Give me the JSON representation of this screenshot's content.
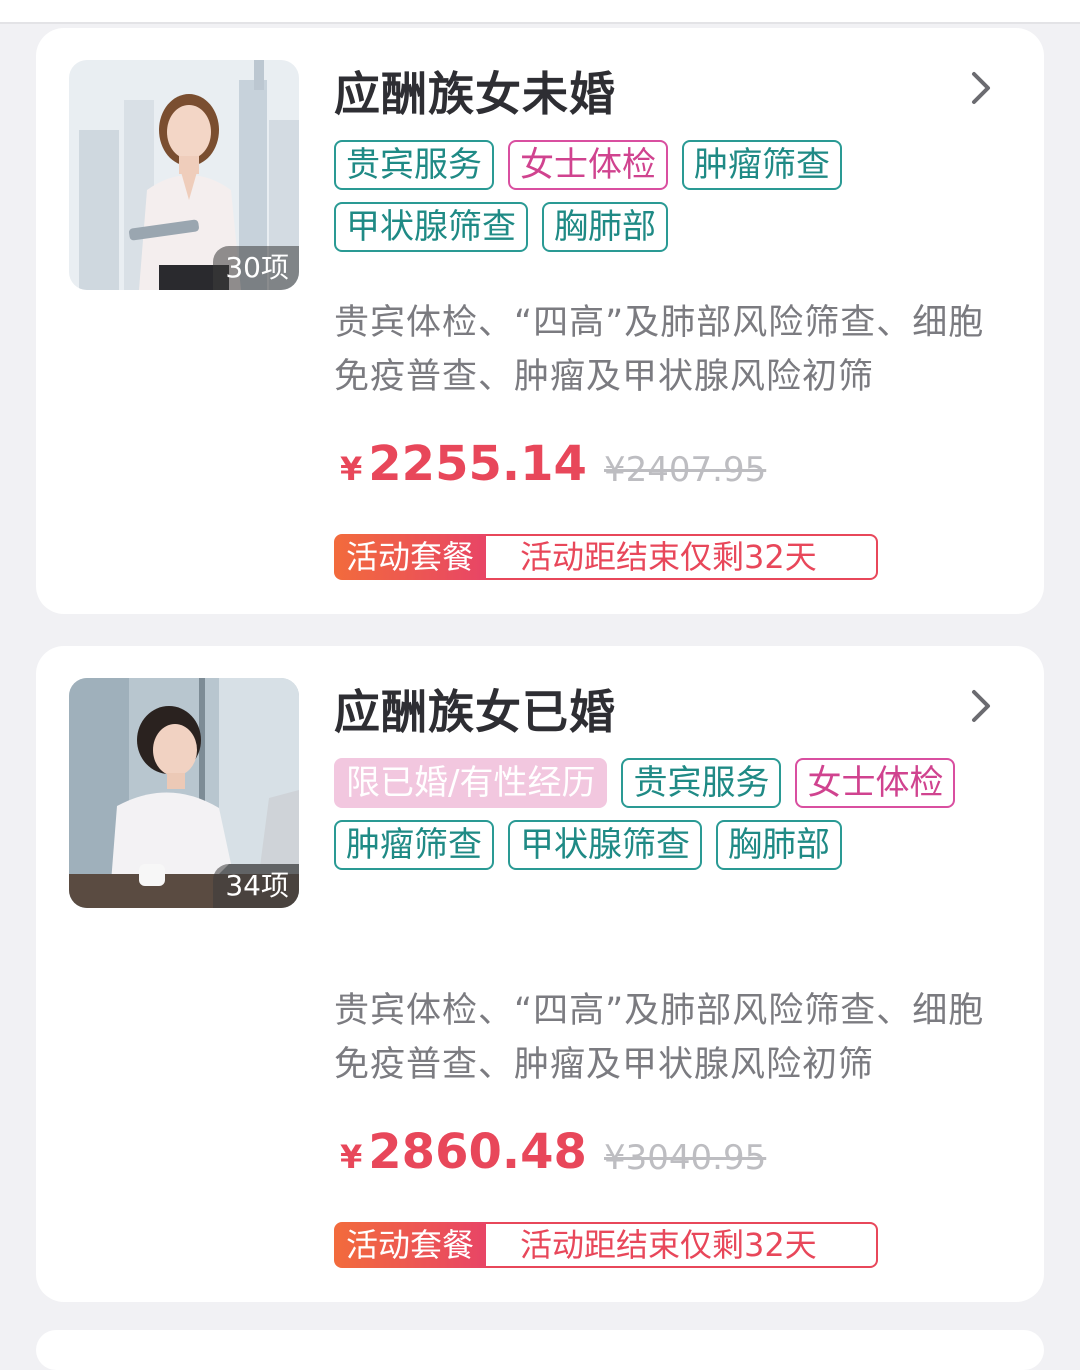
{
  "packages": [
    {
      "title": "应酬族女未婚",
      "item_count": "30项",
      "tags": [
        {
          "label": "贵宾服务",
          "style": "teal"
        },
        {
          "label": "女士体检",
          "style": "pink"
        },
        {
          "label": "肿瘤筛查",
          "style": "teal"
        },
        {
          "label": "甲状腺筛查",
          "style": "teal"
        },
        {
          "label": "胸肺部",
          "style": "teal"
        }
      ],
      "description": "贵宾体检、“四高”及肺部风险筛查、细胞免疫普查、肿瘤及甲状腺风险初筛",
      "currency": "¥",
      "price": "2255.14",
      "original_price": "¥2407.95",
      "promo_label": "活动套餐",
      "promo_countdown": "活动距结束仅剩32天"
    },
    {
      "title": "应酬族女已婚",
      "item_count": "34项",
      "tags": [
        {
          "label": "限已婚/有性经历",
          "style": "fill-pink"
        },
        {
          "label": "贵宾服务",
          "style": "teal"
        },
        {
          "label": "女士体检",
          "style": "pink"
        },
        {
          "label": "肿瘤筛查",
          "style": "teal"
        },
        {
          "label": "甲状腺筛查",
          "style": "teal"
        },
        {
          "label": "胸肺部",
          "style": "teal"
        }
      ],
      "description": "贵宾体检、“四高”及肺部风险筛查、细胞免疫普查、肿瘤及甲状腺风险初筛",
      "currency": "¥",
      "price": "2860.48",
      "original_price": "¥3040.95",
      "promo_label": "活动套餐",
      "promo_countdown": "活动距结束仅剩32天"
    }
  ],
  "colors": {
    "accent_red": "#e8475a",
    "tag_teal": "#2a9a94",
    "tag_pink": "#d94fa0",
    "background": "#f1f1f4"
  },
  "icons": [
    "chevron-right-icon"
  ]
}
